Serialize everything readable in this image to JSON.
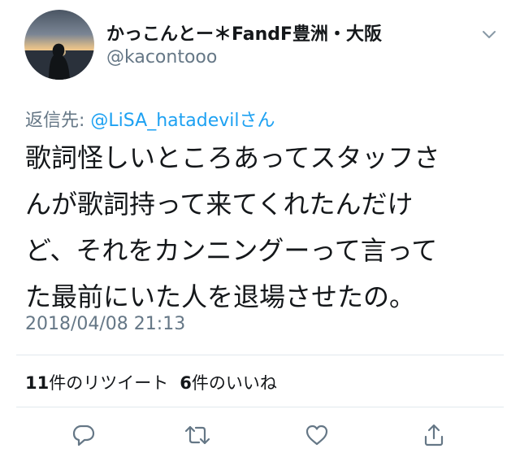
{
  "user": {
    "display_name": "かっこんとー＊FandF豊洲・大阪",
    "handle": "@kacontooo"
  },
  "reply": {
    "prefix": "返信先: ",
    "to_user": "@LiSA_hatadevil",
    "suffix": "さん"
  },
  "tweet": {
    "lines": [
      "歌詞怪しいところあってスタッフさ",
      "んが歌詞持って来てくれたんだけ",
      "ど、それをカンニングーって言って",
      "た最前にいた人を退場させたの。"
    ],
    "timestamp": "2018/04/08 21:13"
  },
  "stats": {
    "retweets_count": "11",
    "retweets_label": "件のリツイート",
    "likes_count": "6",
    "likes_label": "件のいいね"
  },
  "actions": {
    "reply_icon": "comment-icon",
    "retweet_icon": "retweet-icon",
    "like_icon": "heart-icon",
    "share_icon": "share-icon"
  },
  "colors": {
    "link": "#1da1f2",
    "secondary_text": "#657786",
    "divider": "#e1e8ed"
  }
}
